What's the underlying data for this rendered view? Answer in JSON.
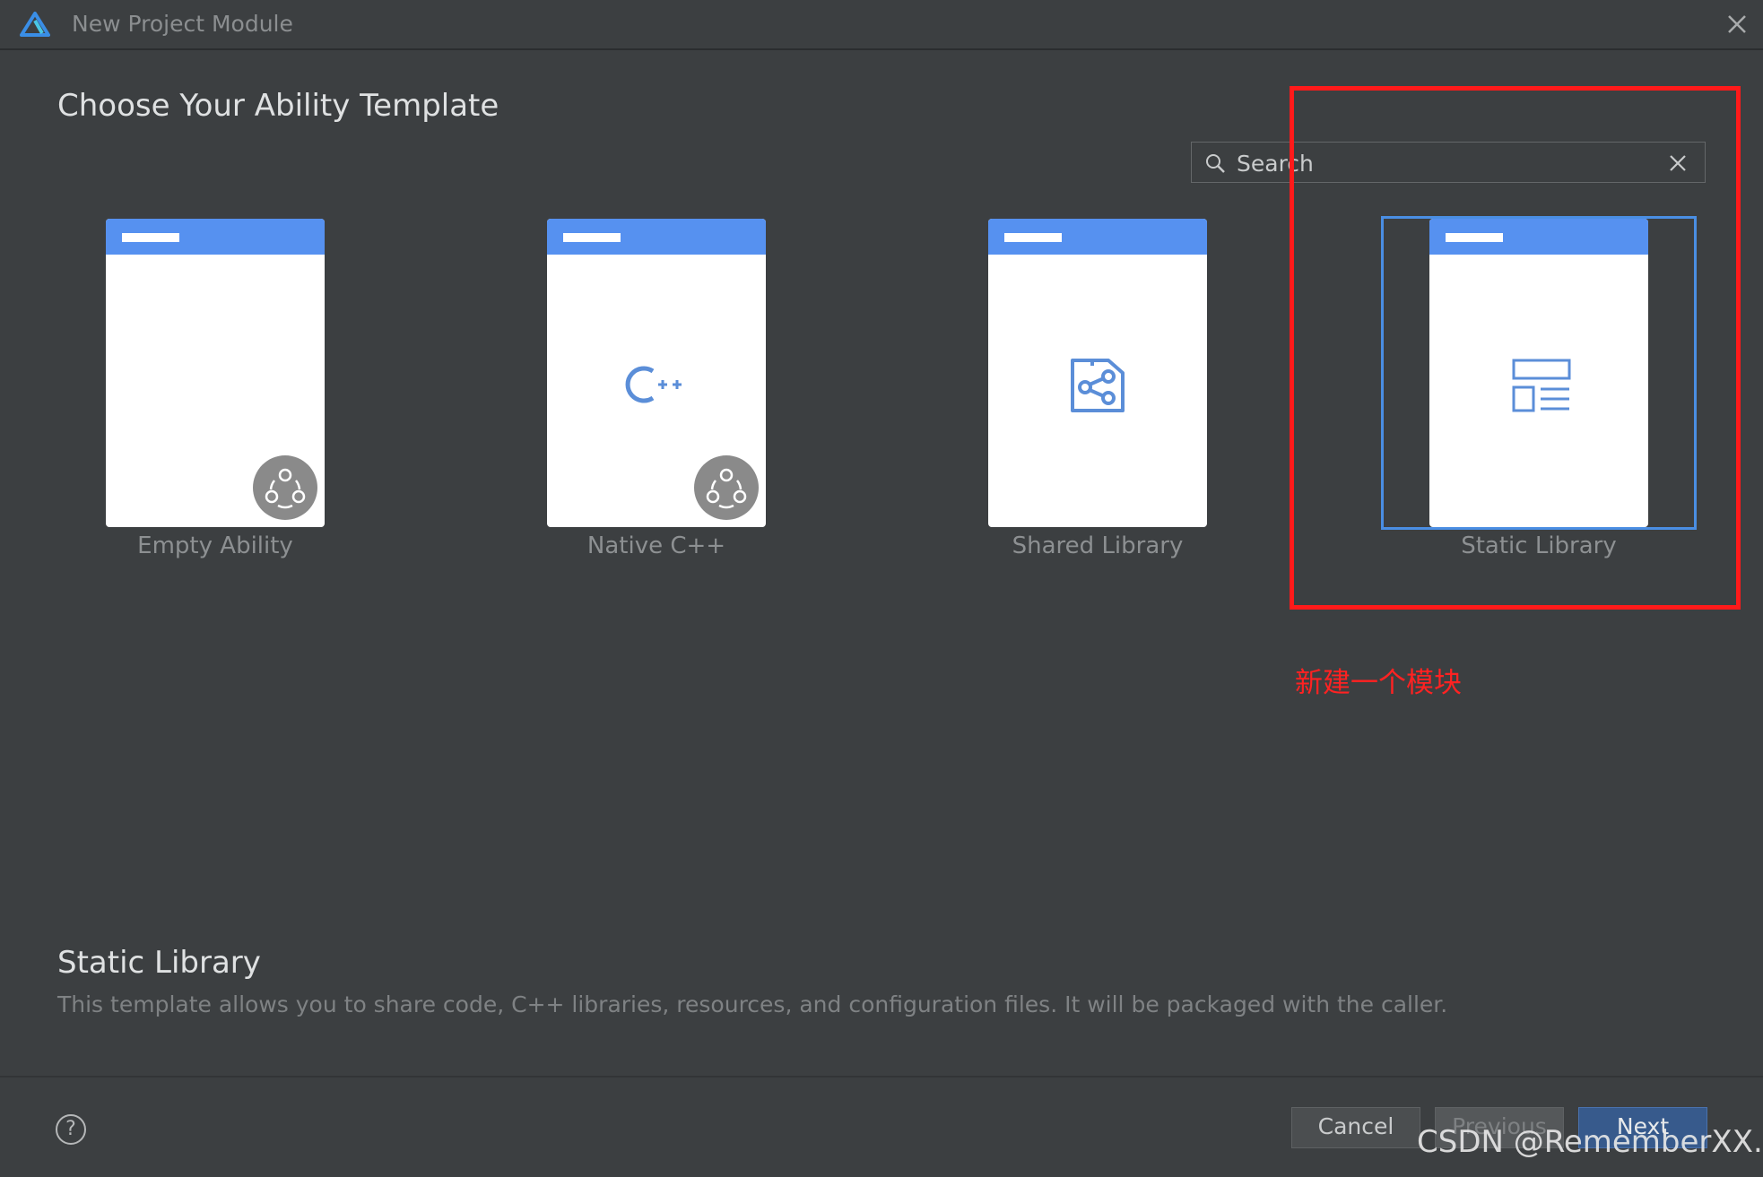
{
  "window": {
    "title": "New Project Module",
    "logo_icon": "deveco-logo-icon",
    "close_icon": "close-icon"
  },
  "heading": "Choose Your Ability Template",
  "search": {
    "placeholder": "Search",
    "value": ""
  },
  "templates": [
    {
      "label": "Empty Ability",
      "icon": "ability-badge-icon",
      "selected": false
    },
    {
      "label": "Native C++",
      "icon": "cpp-icon",
      "selected": false
    },
    {
      "label": "Shared Library",
      "icon": "share-icon",
      "selected": false
    },
    {
      "label": "Static Library",
      "icon": "layout-icon",
      "selected": true
    }
  ],
  "annotation": {
    "text": "新建一个模块",
    "color": "#ff1a1a"
  },
  "description": {
    "title": "Static Library",
    "text": "This template allows you to share code, C++ libraries, resources, and configuration files. It will be packaged with the caller."
  },
  "footer": {
    "help_label": "?",
    "cancel_label": "Cancel",
    "previous_label": "Previous",
    "next_label": "Next"
  },
  "watermark": "CSDN @RememberXX.",
  "colors": {
    "accent": "#5691f0",
    "selection": "#4a8ee3",
    "primary_button": "#375a8c",
    "background": "#3c3f41"
  }
}
